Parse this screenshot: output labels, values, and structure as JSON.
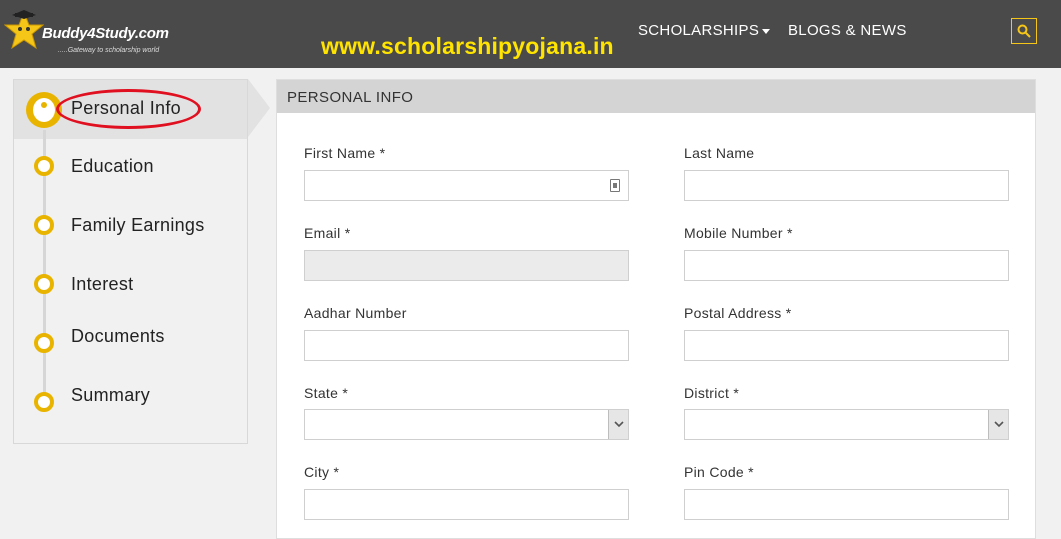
{
  "header": {
    "logo_text": "Buddy4Study.com",
    "logo_tagline": ".....Gateway to scholarship world",
    "watermark": "www.scholarshipyojana.in",
    "nav": {
      "scholarships": "SCHOLARSHIPS",
      "blogs": "BLOGS & NEWS"
    },
    "colors": {
      "bar": "#4a4a4a",
      "accent": "#e9b400",
      "watermark": "#ffe400"
    }
  },
  "sidebar": {
    "items": [
      {
        "label": "Personal Info",
        "active": true
      },
      {
        "label": "Education"
      },
      {
        "label": "Family Earnings"
      },
      {
        "label": "Interest"
      },
      {
        "label": "Documents"
      },
      {
        "label": "Summary"
      }
    ]
  },
  "form": {
    "section_title": "PERSONAL INFO",
    "fields": {
      "first_name": {
        "label": "First Name *",
        "value": ""
      },
      "last_name": {
        "label": "Last Name",
        "value": ""
      },
      "email": {
        "label": "Email *",
        "value": ""
      },
      "mobile": {
        "label": "Mobile Number *",
        "value": ""
      },
      "aadhar": {
        "label": "Aadhar Number",
        "value": ""
      },
      "postal": {
        "label": "Postal Address *",
        "value": ""
      },
      "state": {
        "label": "State *",
        "value": ""
      },
      "district": {
        "label": "District *",
        "value": ""
      },
      "city": {
        "label": "City *",
        "value": ""
      },
      "pincode": {
        "label": "Pin Code *",
        "value": ""
      }
    }
  }
}
